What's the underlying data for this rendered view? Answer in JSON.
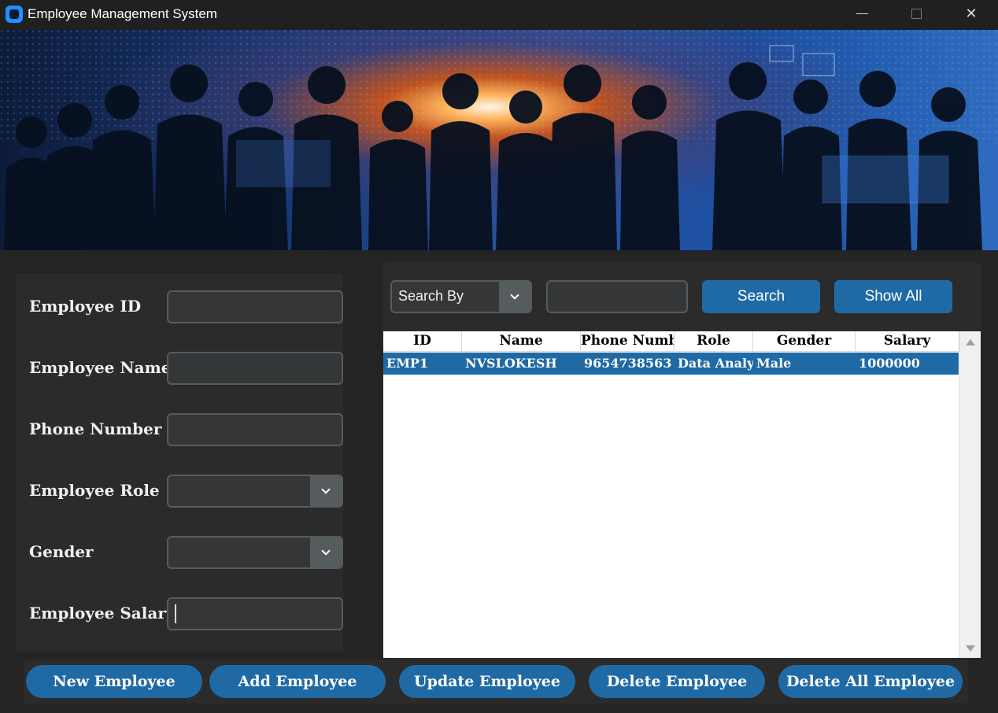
{
  "window": {
    "title": "Employee Management System",
    "minimize": "—",
    "maximize": "☐",
    "close": "✕"
  },
  "form": {
    "labels": {
      "employee_id": "Employee ID",
      "employee_name": "Employee Name",
      "phone_number": "Phone Number",
      "employee_role": "Employee Role",
      "gender": "Gender",
      "employee_salary": "Employee Salary"
    },
    "values": {
      "employee_id": "",
      "employee_name": "",
      "phone_number": "",
      "employee_role": "",
      "gender": "",
      "employee_salary": ""
    }
  },
  "search": {
    "search_by": "Search By",
    "query": "",
    "search_label": "Search",
    "show_all_label": "Show All"
  },
  "table": {
    "columns": [
      "ID",
      "Name",
      "Phone Number",
      "Role",
      "Gender",
      "Salary"
    ],
    "rows": [
      [
        "EMP1",
        "NVSLOKESH",
        "9654738563",
        "Data Analyst",
        "Male",
        "1000000"
      ]
    ]
  },
  "actions": {
    "new_employee": "New Employee",
    "add_employee": "Add Employee",
    "update_employee": "Update Employee",
    "delete_employee": "Delete Employee",
    "delete_all_employee": "Delete All Employee"
  },
  "colors": {
    "accent": "#1f6aa5",
    "background": "#242424",
    "panel": "#2b2b2b"
  }
}
